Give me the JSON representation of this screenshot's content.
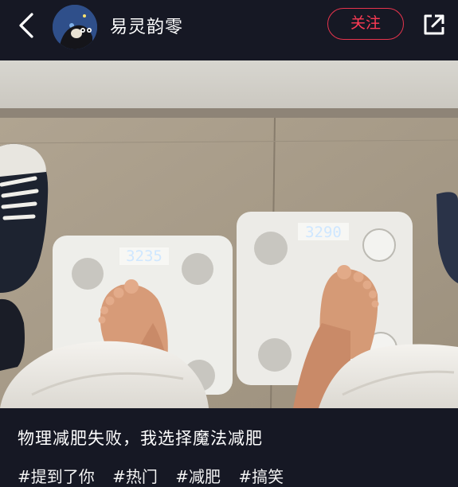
{
  "header": {
    "back_icon": "chevron-left-icon",
    "username": "易灵韵零",
    "follow_label": "关注",
    "share_icon": "share-external-icon",
    "accent_color": "#e8344d"
  },
  "photo": {
    "left_scale_reading": "3235",
    "right_scale_reading": "3290"
  },
  "post": {
    "title": "物理减肥失败，我选择魔法减肥",
    "tags": [
      "#提到了你",
      "#热门",
      "#减肥",
      "#搞笑"
    ]
  }
}
